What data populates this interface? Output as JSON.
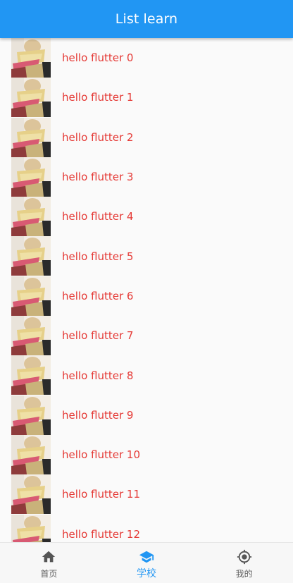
{
  "app_bar": {
    "title": "List learn",
    "color": "#2196f3"
  },
  "list": {
    "label_color": "#e53935",
    "items": [
      {
        "label": "hello flutter 0"
      },
      {
        "label": "hello flutter 1"
      },
      {
        "label": "hello flutter 2"
      },
      {
        "label": "hello flutter 3"
      },
      {
        "label": "hello flutter 4"
      },
      {
        "label": "hello flutter 5"
      },
      {
        "label": "hello flutter 6"
      },
      {
        "label": "hello flutter 7"
      },
      {
        "label": "hello flutter 8"
      },
      {
        "label": "hello flutter 9"
      },
      {
        "label": "hello flutter 10"
      },
      {
        "label": "hello flutter 11"
      },
      {
        "label": "hello flutter 12"
      }
    ]
  },
  "bottom_nav": {
    "active_color": "#2196f3",
    "items": [
      {
        "label": "首页",
        "icon": "home-icon",
        "active": false
      },
      {
        "label": "学校",
        "icon": "school-icon",
        "active": true
      },
      {
        "label": "我的",
        "icon": "location-target-icon",
        "active": false
      }
    ]
  }
}
